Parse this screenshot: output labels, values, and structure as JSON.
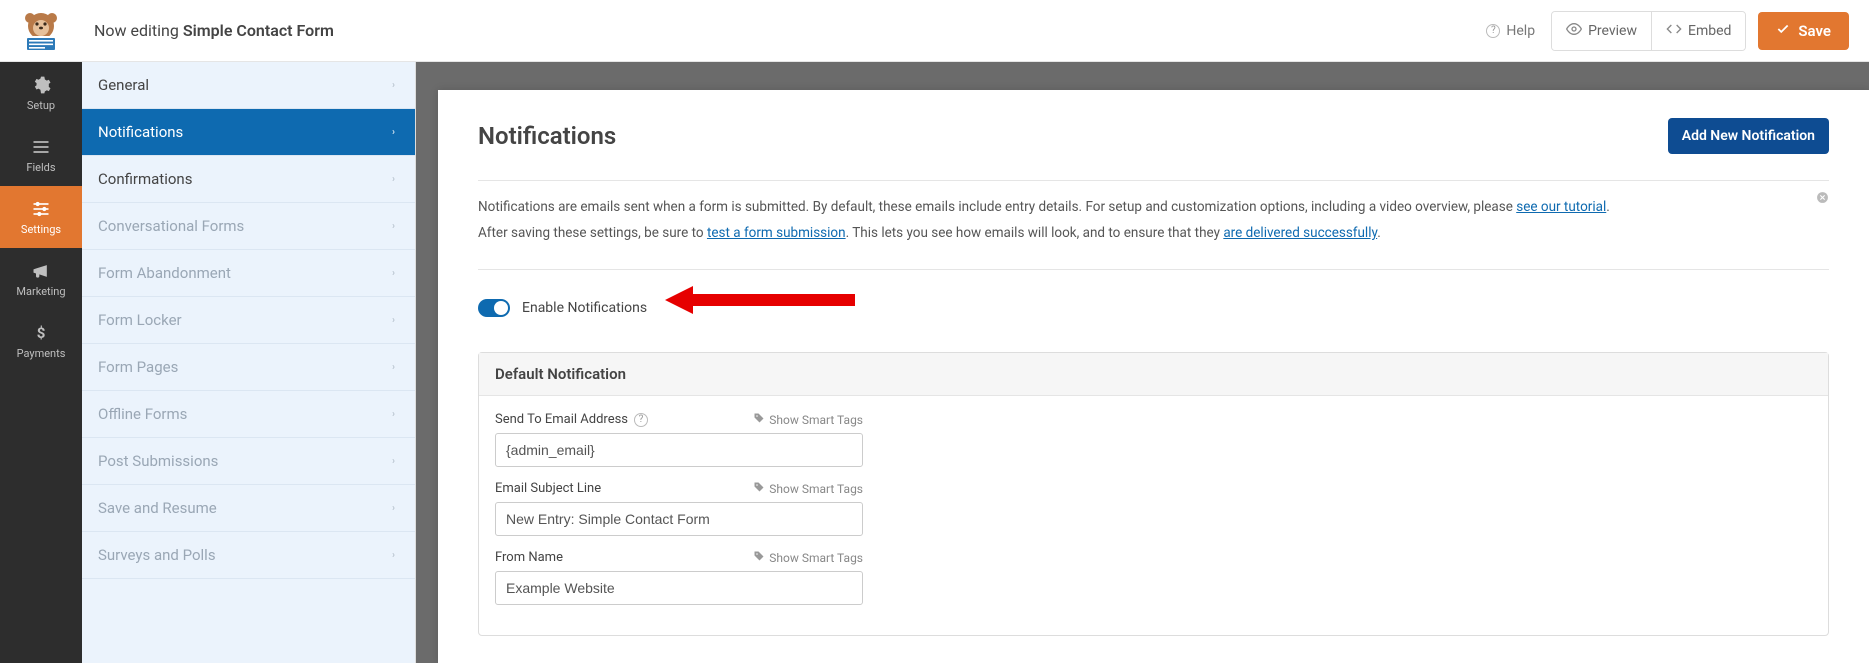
{
  "topbar": {
    "editing_prefix": "Now editing ",
    "form_name": "Simple Contact Form",
    "help": "Help",
    "preview": "Preview",
    "embed": "Embed",
    "save": "Save"
  },
  "rail": [
    {
      "key": "setup",
      "label": "Setup"
    },
    {
      "key": "fields",
      "label": "Fields"
    },
    {
      "key": "settings",
      "label": "Settings"
    },
    {
      "key": "marketing",
      "label": "Marketing"
    },
    {
      "key": "payments",
      "label": "Payments"
    }
  ],
  "subnav": [
    {
      "key": "general",
      "label": "General",
      "chev": "›",
      "style": "normal"
    },
    {
      "key": "notifications",
      "label": "Notifications",
      "chev": "›",
      "style": "active"
    },
    {
      "key": "confirmations",
      "label": "Confirmations",
      "chev": "›",
      "style": "normal"
    },
    {
      "key": "conversational",
      "label": "Conversational Forms",
      "chev": "›",
      "style": "disabled"
    },
    {
      "key": "abandonment",
      "label": "Form Abandonment",
      "chev": "›",
      "style": "disabled"
    },
    {
      "key": "locker",
      "label": "Form Locker",
      "chev": "›",
      "style": "disabled"
    },
    {
      "key": "pages",
      "label": "Form Pages",
      "chev": "›",
      "style": "disabled"
    },
    {
      "key": "offline",
      "label": "Offline Forms",
      "chev": "›",
      "style": "disabled"
    },
    {
      "key": "post",
      "label": "Post Submissions",
      "chev": "›",
      "style": "disabled"
    },
    {
      "key": "saveresume",
      "label": "Save and Resume",
      "chev": "›",
      "style": "disabled"
    },
    {
      "key": "surveys",
      "label": "Surveys and Polls",
      "chev": "›",
      "style": "disabled"
    }
  ],
  "page": {
    "title": "Notifications",
    "add_btn": "Add New Notification",
    "intro_parts": {
      "p1a": "Notifications are emails sent when a form is submitted. By default, these emails include entry details. For setup and customization options, including a video overview, please ",
      "p1link": "see our tutorial",
      "p1b": ".",
      "p2a": "After saving these settings, be sure to ",
      "p2link1": "test a form submission",
      "p2b": ". This lets you see how emails will look, and to ensure that they ",
      "p2link2": "are delivered successfully",
      "p2c": "."
    },
    "enable_label": "Enable Notifications",
    "card_title": "Default Notification",
    "smart_tags_label": "Show Smart Tags",
    "fields": {
      "sendto": {
        "label": "Send To Email Address",
        "value": "{admin_email}"
      },
      "subject": {
        "label": "Email Subject Line",
        "value": "New Entry: Simple Contact Form"
      },
      "fromname": {
        "label": "From Name",
        "value": "Example Website"
      }
    }
  }
}
